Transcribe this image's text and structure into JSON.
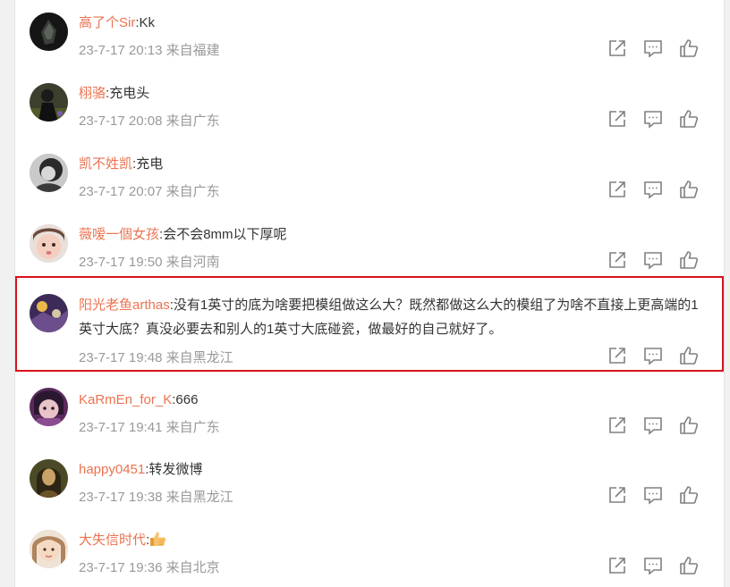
{
  "comments": [
    {
      "user": "高了个Sir",
      "sep": ":",
      "text": "Kk",
      "date": "23-7-17 20:13",
      "source": "来自福建"
    },
    {
      "user": "栩骆",
      "sep": ":",
      "text": "充电头",
      "date": "23-7-17 20:08",
      "source": "来自广东"
    },
    {
      "user": "凯不姓凯",
      "sep": ":",
      "text": "充电",
      "date": "23-7-17 20:07",
      "source": "来自广东"
    },
    {
      "user": "薇嗳一個女孩",
      "sep": ":",
      "text": "会不会8mm以下厚呢",
      "date": "23-7-17 19:50",
      "source": "来自河南"
    },
    {
      "user": "阳光老鱼arthas",
      "sep": ":",
      "text": "没有1英寸的底为啥要把模组做这么大？既然都做这么大的模组了为啥不直接上更高端的1英寸大底？真没必要去和别人的1英寸大底碰瓷，做最好的自己就好了。",
      "date": "23-7-17 19:48",
      "source": "来自黑龙江"
    },
    {
      "user": "KaRmEn_for_K",
      "sep": ":",
      "text": "666",
      "date": "23-7-17 19:41",
      "source": "来自广东"
    },
    {
      "user": "happy0451",
      "sep": ":",
      "text": "转发微博",
      "date": "23-7-17 19:38",
      "source": "来自黑龙江"
    },
    {
      "user": "大失信时代",
      "sep": ":",
      "text": "",
      "emoji": "thumbs-up-emoji",
      "date": "23-7-17 19:36",
      "source": "来自北京"
    }
  ],
  "icons": {
    "share": "share-icon",
    "comment": "comment-icon",
    "like": "like-icon"
  },
  "colors": {
    "username": "#eb7350",
    "text": "#333333",
    "meta": "#999999",
    "icon": "#808080",
    "highlight_border": "#d9121b"
  }
}
